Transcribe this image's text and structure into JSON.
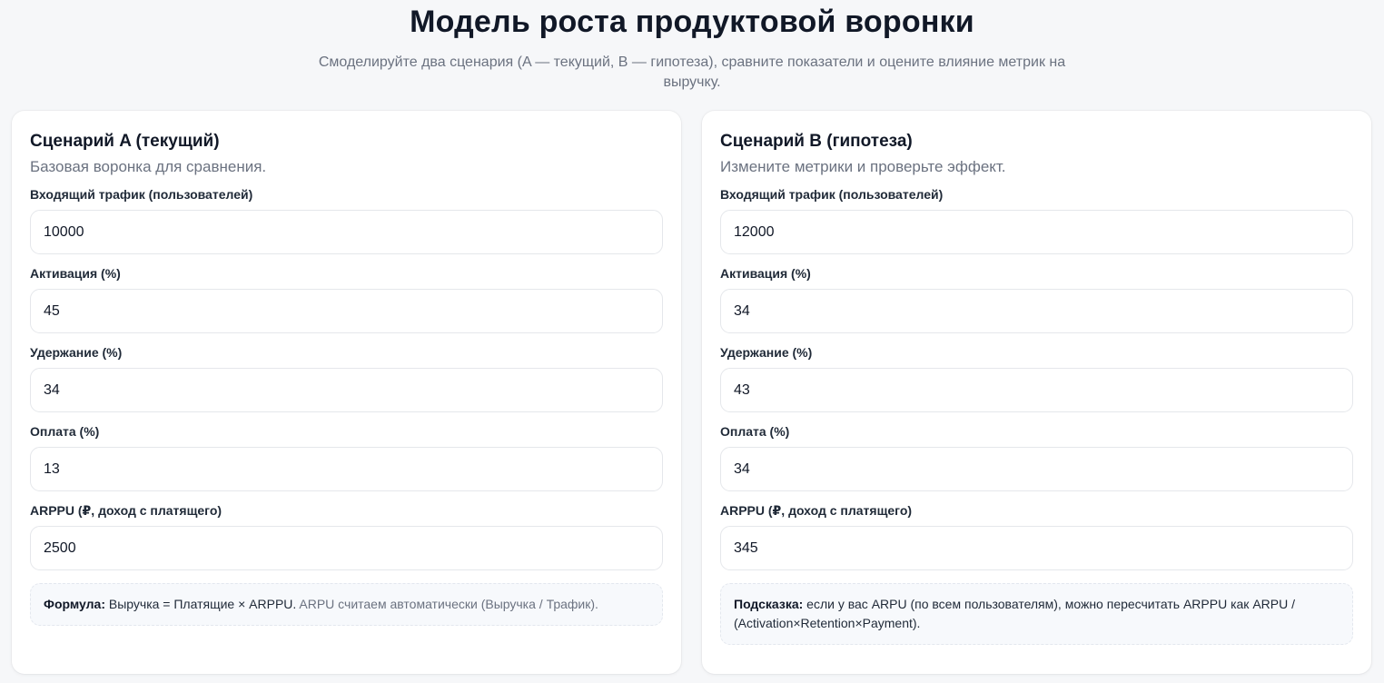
{
  "header": {
    "title": "Модель роста продуктовой воронки",
    "subtitle": "Смоделируйте два сценария (A — текущий, B — гипотеза), сравните показатели и оцените влияние метрик на выручку."
  },
  "scenario_a": {
    "title": "Сценарий A (текущий)",
    "description": "Базовая воронка для сравнения.",
    "fields": [
      {
        "label": "Входящий трафик (пользователей)",
        "value": "10000"
      },
      {
        "label": "Активация (%)",
        "value": "45"
      },
      {
        "label": "Удержание (%)",
        "value": "34"
      },
      {
        "label": "Оплата (%)",
        "value": "13"
      },
      {
        "label": "ARPPU (₽, доход с платящего)",
        "value": "2500"
      }
    ],
    "note": {
      "strong": "Формула:",
      "text": " Выручка = Платящие × ARPPU.",
      "muted": " ARPU считаем автоматически (Выручка / Трафик)."
    }
  },
  "scenario_b": {
    "title": "Сценарий B (гипотеза)",
    "description": "Измените метрики и проверьте эффект.",
    "fields": [
      {
        "label": "Входящий трафик (пользователей)",
        "value": "12000"
      },
      {
        "label": "Активация (%)",
        "value": "34"
      },
      {
        "label": "Удержание (%)",
        "value": "43"
      },
      {
        "label": "Оплата (%)",
        "value": "34"
      },
      {
        "label": "ARPPU (₽, доход с платящего)",
        "value": "345"
      }
    ],
    "note": {
      "strong": "Подсказка:",
      "text": " если у вас ARPU (по всем пользователям), можно пересчитать ARPPU как ARPU / (Activation×Retention×Payment)."
    }
  }
}
